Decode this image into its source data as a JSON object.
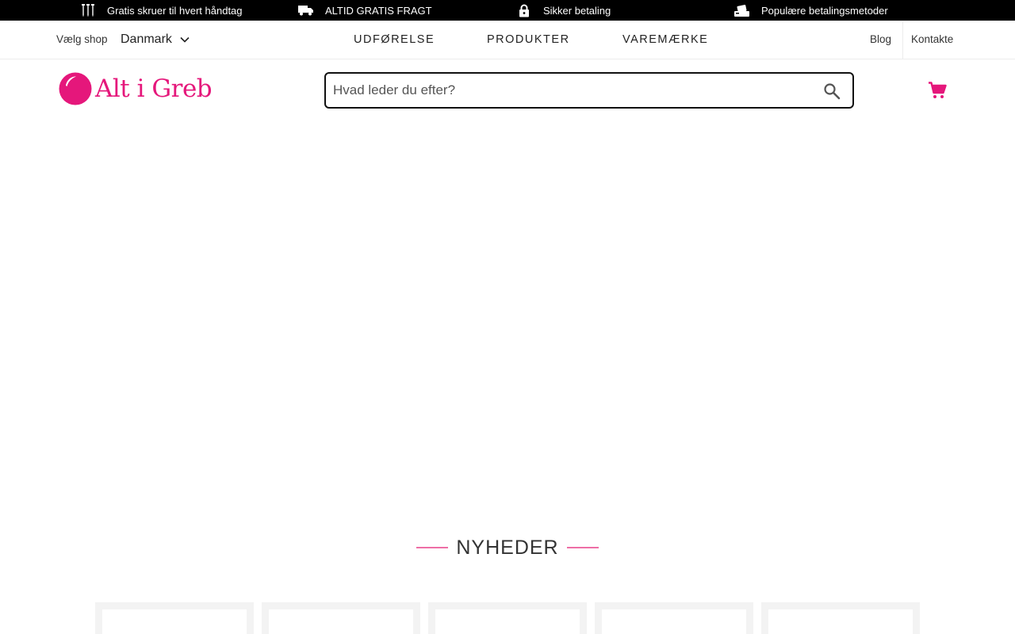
{
  "topbar": {
    "items": [
      {
        "icon": "screws-icon",
        "text": "Gratis skruer til hvert håndtag"
      },
      {
        "icon": "truck-icon",
        "text": "ALTID GRATIS FRAGT"
      },
      {
        "icon": "lock-icon",
        "text": "Sikker betaling"
      },
      {
        "icon": "payment-icon",
        "text": "Populære betalingsmetoder"
      }
    ]
  },
  "shop": {
    "label": "Vælg shop",
    "selected": "Danmark"
  },
  "nav": {
    "items": [
      "UDFØRELSE",
      "PRODUKTER",
      "VAREMÆRKE"
    ]
  },
  "util": {
    "blog": "Blog",
    "contact": "Kontakte"
  },
  "logo": {
    "text": "Alt i Greb"
  },
  "search": {
    "placeholder": "Hvad leder du efter?",
    "value": ""
  },
  "section": {
    "title": "NYHEDER"
  },
  "colors": {
    "brand": "#e5177b",
    "accent_rule": "#ee6fa6",
    "topbar_bg": "#000000"
  }
}
